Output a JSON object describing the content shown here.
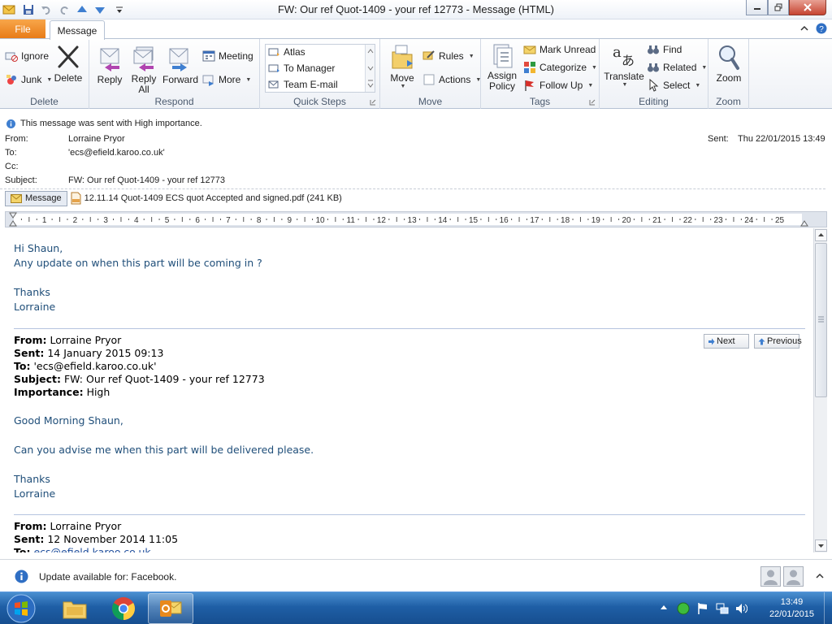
{
  "window": {
    "title": "FW: Our ref Quot-1409 - your ref 12773  - Message (HTML)"
  },
  "tabs": {
    "file": "File",
    "message": "Message"
  },
  "ribbon": {
    "delete_group": {
      "label": "Delete",
      "ignore": "Ignore",
      "junk": "Junk",
      "delete": "Delete"
    },
    "respond_group": {
      "label": "Respond",
      "reply": "Reply",
      "reply_all_1": "Reply",
      "reply_all_2": "All",
      "forward": "Forward",
      "meeting": "Meeting",
      "more": "More"
    },
    "quicksteps_group": {
      "label": "Quick Steps",
      "items": [
        "Atlas",
        "To Manager",
        "Team E-mail"
      ]
    },
    "move_group": {
      "label": "Move",
      "move": "Move",
      "rules": "Rules",
      "actions": "Actions"
    },
    "tags_group": {
      "label": "Tags",
      "assign_1": "Assign",
      "assign_2": "Policy",
      "mark_unread": "Mark Unread",
      "categorize": "Categorize",
      "follow_up": "Follow Up"
    },
    "editing_group": {
      "label": "Editing",
      "translate": "Translate",
      "find": "Find",
      "related": "Related",
      "select": "Select"
    },
    "zoom_group": {
      "label": "Zoom",
      "zoom": "Zoom"
    }
  },
  "header": {
    "importance": "This message was sent with High importance.",
    "from_label": "From:",
    "from_value": "Lorraine Pryor",
    "to_label": "To:",
    "to_value": "'ecs@efield.karoo.co.uk'",
    "cc_label": "Cc:",
    "cc_value": "",
    "subject_label": "Subject:",
    "subject_value": "FW: Our ref Quot-1409 - your ref 12773",
    "sent_label": "Sent:",
    "sent_value": "Thu 22/01/2015 13:49"
  },
  "attachments": {
    "message_tab": "Message",
    "file": "12.11.14 Quot-1409 ECS quot Accepted and signed.pdf (241 KB)"
  },
  "ruler": {
    "marks": [
      "1",
      "2",
      "3",
      "4",
      "5",
      "6",
      "7",
      "8",
      "9",
      "10",
      "11",
      "12",
      "13",
      "14",
      "15",
      "16",
      "17",
      "18",
      "19",
      "20",
      "21",
      "22",
      "23",
      "24",
      "25"
    ]
  },
  "body": {
    "greeting": "Hi Shaun,",
    "line1": "Any update on when this part will be coming in ?",
    "thanks": "Thanks",
    "name": "Lorraine",
    "fwd1": {
      "from_label": "From:",
      "from": "Lorraine Pryor",
      "sent_label": "Sent:",
      "sent": "14 January 2015 09:13",
      "to_label": "To:",
      "to": "'ecs@efield.karoo.co.uk'",
      "subject_label": "Subject:",
      "subject": "FW: Our ref Quot-1409 - your ref 12773",
      "importance_label": "Importance:",
      "importance": "High",
      "greeting": "Good Morning Shaun,",
      "line1": "Can you advise me when this part will be delivered please.",
      "thanks": "Thanks",
      "name": "Lorraine"
    },
    "fwd2": {
      "from_label": "From:",
      "from": "Lorraine Pryor",
      "sent_label": "Sent:",
      "sent": "12 November 2014 11:05",
      "to_label": "To:",
      "to": "ecs@efield.karoo.co.uk"
    },
    "next": "Next",
    "previous": "Previous"
  },
  "status": {
    "text": "Update available for: Facebook."
  },
  "taskbar": {
    "time": "13:49",
    "date": "22/01/2015"
  }
}
